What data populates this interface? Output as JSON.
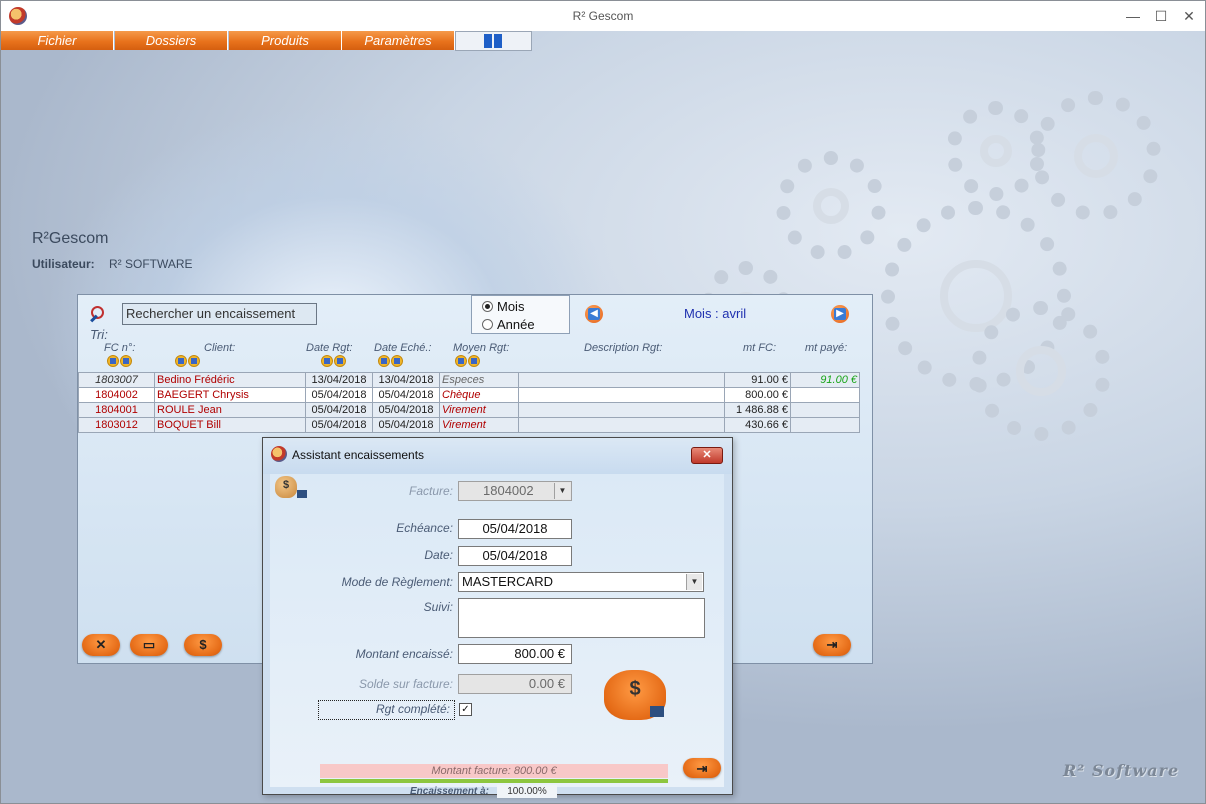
{
  "window": {
    "title": "R² Gescom",
    "minimize": "—",
    "maximize": "☐",
    "close": "✕"
  },
  "menu": [
    "Fichier",
    "Dossiers",
    "Produits",
    "Paramètres"
  ],
  "brand": {
    "app_name": "R²Gescom",
    "user_label": "Utilisateur:",
    "user_value": "R² SOFTWARE"
  },
  "watermark": "R² Software",
  "list": {
    "search_placeholder": "Rechercher un encaissement",
    "period_options": [
      {
        "label": "Mois",
        "selected": true
      },
      {
        "label": "Année",
        "selected": false
      }
    ],
    "period_label": "Mois : avril",
    "sort_label": "Tri:",
    "columns": [
      "FC n°:",
      "Client:",
      "Date Rgt:",
      "Date Eché.:",
      "Moyen Rgt:",
      "Description Rgt:",
      "mt FC:",
      "mt payé:"
    ],
    "rows": [
      {
        "fc": "1803007",
        "client": "Bedino Frédéric",
        "date_rgt": "13/04/2018",
        "date_ech": "13/04/2018",
        "moyen": "Especes",
        "description": "",
        "mt_fc": "91.00 €",
        "mt_paye": "91.00 €"
      },
      {
        "fc": "1804002",
        "client": "BAEGERT Chrysis",
        "date_rgt": "05/04/2018",
        "date_ech": "05/04/2018",
        "moyen": "Chèque",
        "description": "",
        "mt_fc": "800.00 €",
        "mt_paye": ""
      },
      {
        "fc": "1804001",
        "client": "ROULE Jean",
        "date_rgt": "05/04/2018",
        "date_ech": "05/04/2018",
        "moyen": "Virement",
        "description": "",
        "mt_fc": "1 486.88 €",
        "mt_paye": ""
      },
      {
        "fc": "1803012",
        "client": "BOQUET Bill",
        "date_rgt": "05/04/2018",
        "date_ech": "05/04/2018",
        "moyen": "Virement",
        "description": "",
        "mt_fc": "430.66 €",
        "mt_paye": ""
      }
    ],
    "buttons": {
      "delete_icon": "✕",
      "card_icon": "▭",
      "bag_icon": "$",
      "exit_icon": "⇥"
    }
  },
  "dialog": {
    "title": "Assistant encaissements",
    "close_icon": "✕",
    "facture_label": "Facture:",
    "facture_value": "1804002",
    "echeance_label": "Echéance:",
    "echeance_value": "05/04/2018",
    "date_label": "Date:",
    "date_value": "05/04/2018",
    "mode_label": "Mode de Règlement:",
    "mode_value": "MASTERCARD",
    "suivi_label": "Suivi:",
    "suivi_value": "",
    "montant_label": "Montant encaissé:",
    "montant_value": "800.00 €",
    "solde_label": "Solde sur facture:",
    "solde_value": "0.00 €",
    "complete_label": "Rgt complété:",
    "complete_checked": true,
    "montant_facture": "Montant facture:  800.00 €",
    "encaissement_label": "Encaissement à:",
    "encaissement_value": "100.00%",
    "encaissement_fraction": 1.0,
    "dollar": "$"
  }
}
